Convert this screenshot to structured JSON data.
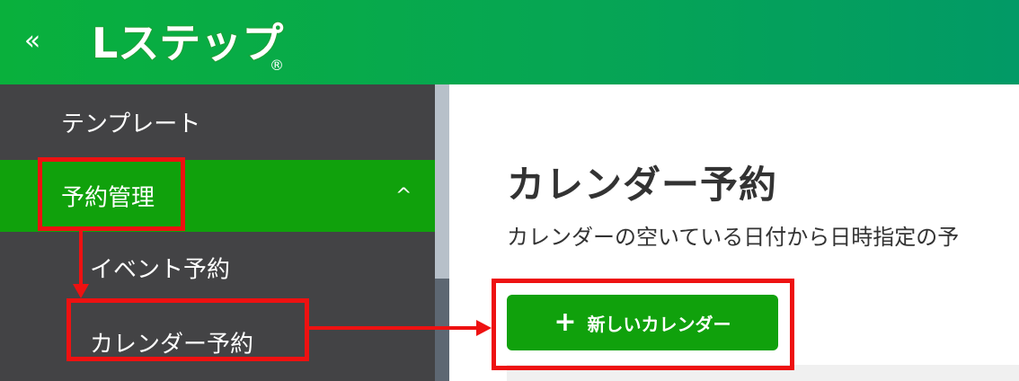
{
  "header": {
    "collapse_icon": "double-chevron-left-icon",
    "collapse_glyph": "«",
    "logo_text": "Lステップ",
    "logo_mark": "®",
    "colors": {
      "start": "#09b03c",
      "end": "#029a66"
    }
  },
  "sidebar": {
    "items": [
      {
        "label": "テンプレート",
        "active": false
      },
      {
        "label": "予約管理",
        "active": true,
        "expand_icon": "chevron-up-icon",
        "expand_glyph": "^"
      },
      {
        "label": "イベント予約",
        "active": false
      },
      {
        "label": "カレンダー予約",
        "active": false
      }
    ],
    "colors": {
      "background": "#434345",
      "active": "#10a10c"
    }
  },
  "main": {
    "title": "カレンダー予約",
    "description": "カレンダーの空いている日付から日時指定の予",
    "new_button": {
      "icon": "plus-icon",
      "icon_glyph": "+",
      "label": "新しいカレンダー"
    }
  },
  "annotations": {
    "highlight_color": "#ee1111"
  }
}
